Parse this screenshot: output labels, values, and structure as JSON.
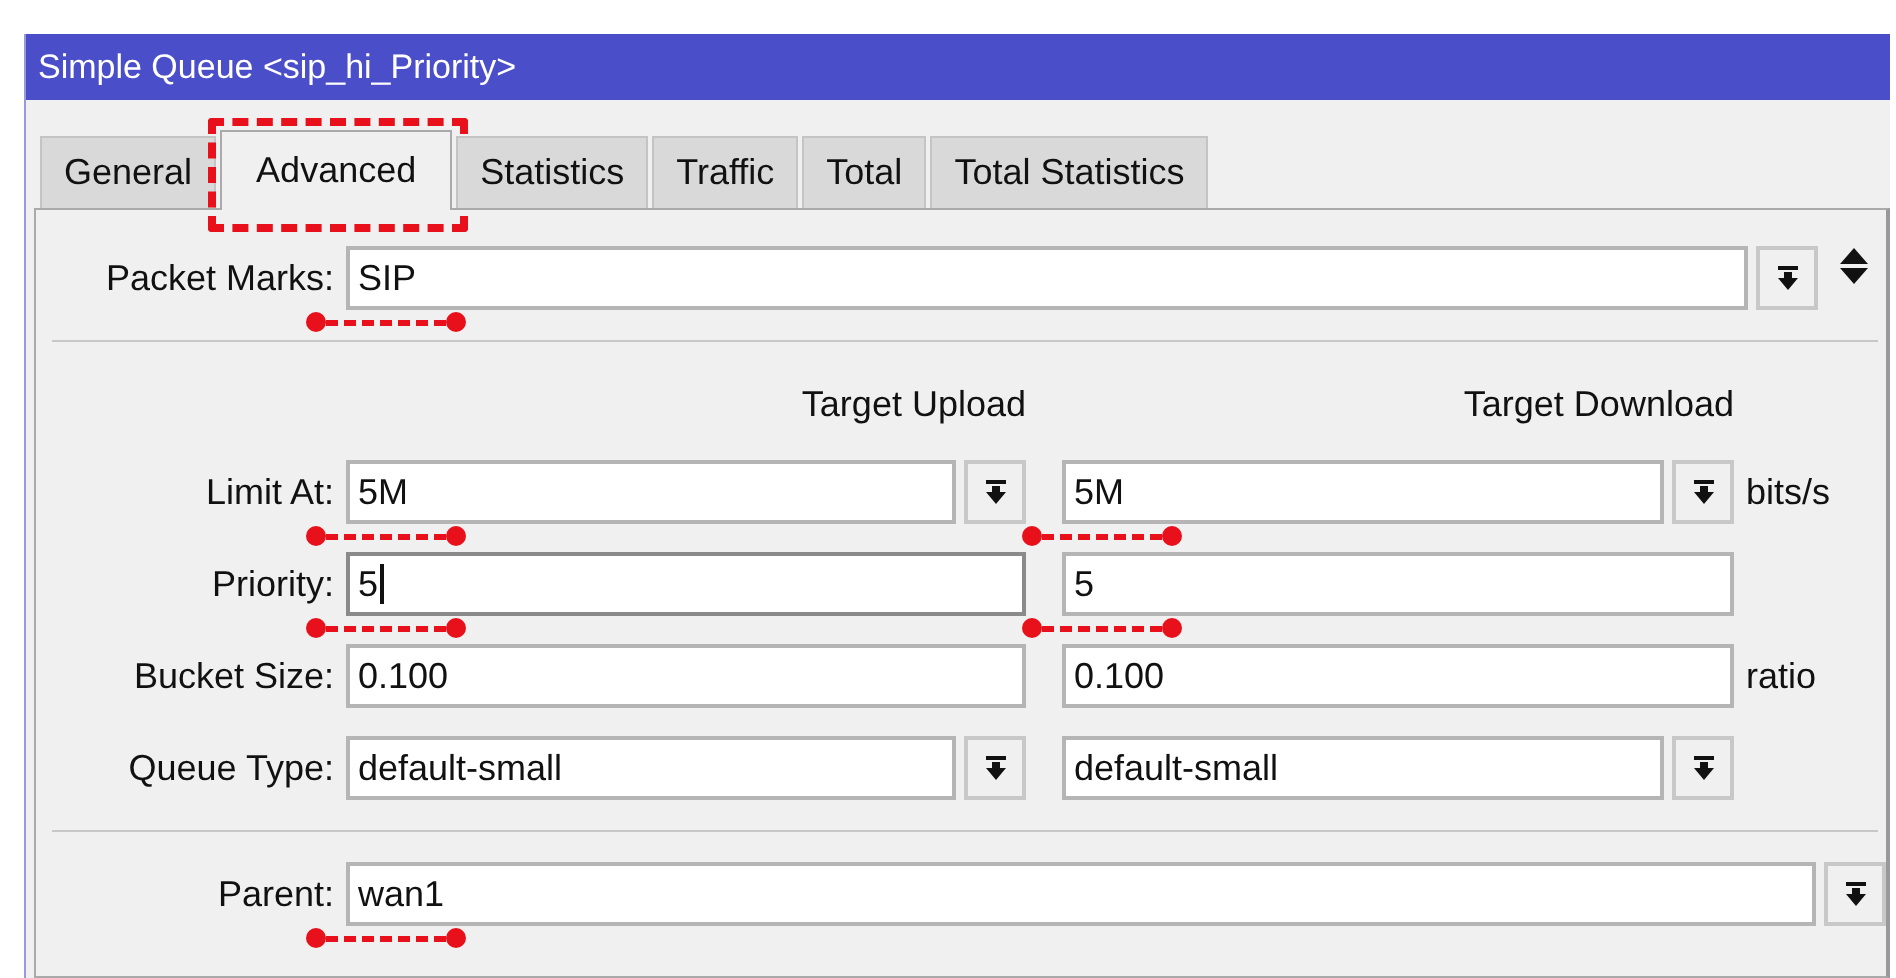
{
  "window": {
    "title": "Simple Queue <sip_hi_Priority>"
  },
  "tabs": [
    {
      "label": "General",
      "selected": false,
      "annotated": false
    },
    {
      "label": "Advanced",
      "selected": true,
      "annotated": true
    },
    {
      "label": "Statistics",
      "selected": false,
      "annotated": false
    },
    {
      "label": "Traffic",
      "selected": false,
      "annotated": false
    },
    {
      "label": "Total",
      "selected": false,
      "annotated": false
    },
    {
      "label": "Total Statistics",
      "selected": false,
      "annotated": false
    }
  ],
  "packet_marks": {
    "label": "Packet Marks:",
    "value": "SIP",
    "annotated": true
  },
  "columns": [
    "Target Upload",
    "Target Download"
  ],
  "rows": [
    {
      "label": "Limit At:",
      "kind": "dropdown",
      "unit": "bits/s",
      "upload": {
        "value": "5M",
        "annotated": true,
        "focused": false
      },
      "download": {
        "value": "5M",
        "annotated": true,
        "focused": false
      }
    },
    {
      "label": "Priority:",
      "kind": "text",
      "upload": {
        "value": "5",
        "annotated": true,
        "focused": true
      },
      "download": {
        "value": "5",
        "annotated": true,
        "focused": false
      }
    },
    {
      "label": "Bucket Size:",
      "kind": "text",
      "unit": "ratio",
      "upload": {
        "value": "0.100",
        "annotated": false,
        "focused": false
      },
      "download": {
        "value": "0.100",
        "annotated": false,
        "focused": false
      }
    },
    {
      "label": "Queue Type:",
      "kind": "dropdown",
      "upload": {
        "value": "default-small",
        "annotated": false,
        "focused": false
      },
      "download": {
        "value": "default-small",
        "annotated": false,
        "focused": false
      }
    }
  ],
  "parent": {
    "label": "Parent:",
    "value": "wan1",
    "annotated": true
  }
}
